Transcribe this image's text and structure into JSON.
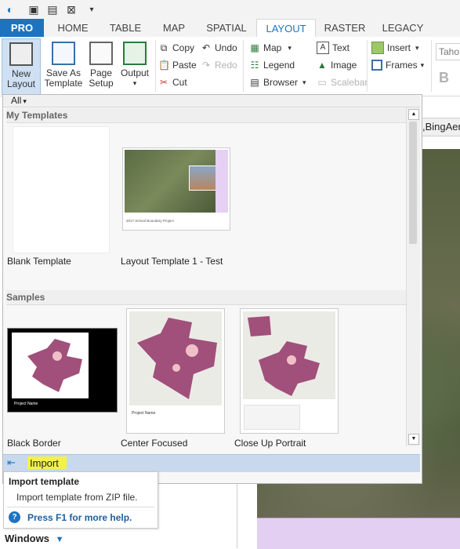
{
  "tabs": [
    "PRO",
    "HOME",
    "TABLE",
    "MAP",
    "SPATIAL",
    "LAYOUT",
    "RASTER",
    "LEGACY"
  ],
  "ribbon": {
    "new_layout": [
      "New",
      "Layout"
    ],
    "save_as_template": [
      "Save As",
      "Template"
    ],
    "page_setup": [
      "Page",
      "Setup"
    ],
    "output": "Output",
    "copy": "Copy",
    "paste": "Paste",
    "cut": "Cut",
    "undo": "Undo",
    "redo": "Redo",
    "map": "Map",
    "legend": "Legend",
    "browser": "Browser",
    "text": "Text",
    "image": "Image",
    "scalebar": "Scalebar",
    "insert": "Insert",
    "frames": "Frames",
    "font_name": "Taho",
    "bold": "B"
  },
  "gallery": {
    "filter": "All",
    "my_templates_heading": "My Templates",
    "samples_heading": "Samples",
    "my_templates": [
      {
        "caption": "Blank Template"
      },
      {
        "caption": "Layout Template 1  - Test",
        "thumb_text": "2017 School Boundary Project"
      }
    ],
    "samples": [
      {
        "caption": "Black Border",
        "thumb_text": "Project Name"
      },
      {
        "caption": "Center Focused",
        "thumb_text": "Project Name"
      },
      {
        "caption": "Close Up Portrait"
      }
    ],
    "import_label": "Import"
  },
  "tooltip": {
    "title": "Import template",
    "body": "Import template from ZIP file.",
    "help": "Press F1 for more help."
  },
  "left_pane": {
    "windows_label": "Windows"
  },
  "map_tab_label": ",BingAer",
  "colors": {
    "accent": "#1e73be",
    "highlight": "#f2f24a",
    "template_purple": "#a0507a"
  }
}
